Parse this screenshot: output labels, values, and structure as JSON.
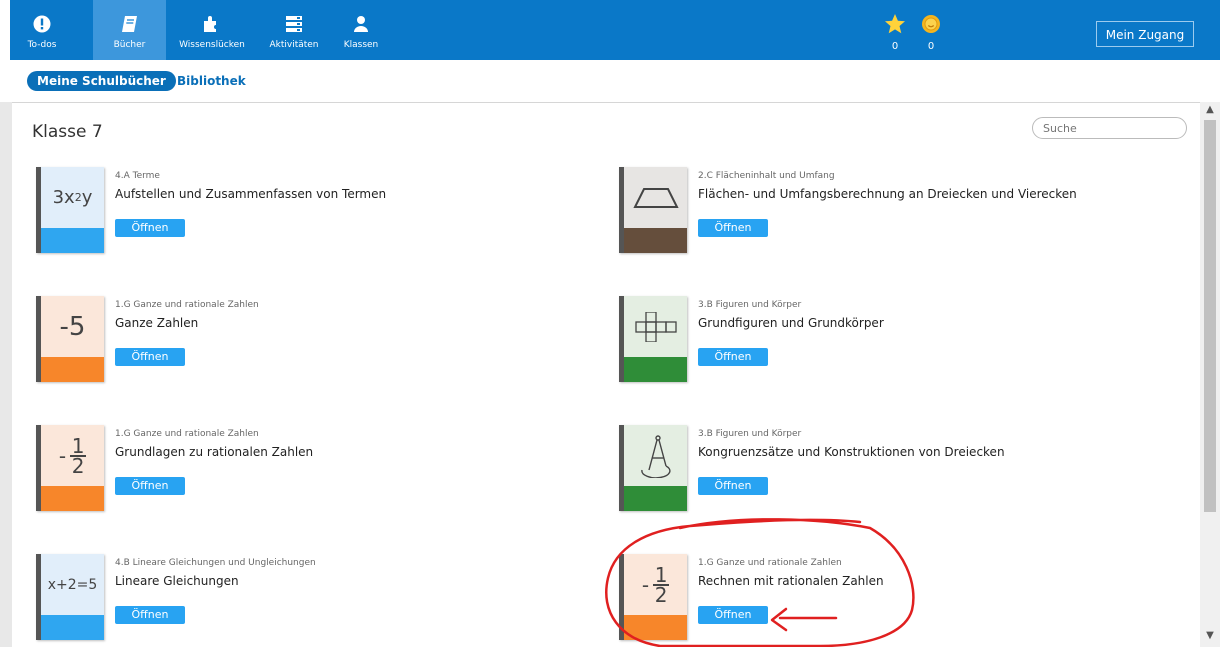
{
  "nav": {
    "items": [
      {
        "label": "To-dos",
        "icon": "exclamation-icon"
      },
      {
        "label": "Bücher",
        "icon": "book-icon"
      },
      {
        "label": "Wissenslücken",
        "icon": "puzzle-icon"
      },
      {
        "label": "Aktivitäten",
        "icon": "activities-icon"
      },
      {
        "label": "Klassen",
        "icon": "person-icon"
      }
    ],
    "stars": "0",
    "coins": "0",
    "account_label": "Mein Zugang"
  },
  "subnav": {
    "my_books": "Meine Schulbücher",
    "library": "Bibliothek"
  },
  "section": {
    "title": "Klasse 7",
    "search_placeholder": "Suche"
  },
  "open_label": "Öffnen",
  "colors": {
    "topbar": "#0a78c8",
    "button": "#28a3f2",
    "blue_cover": "#2fa6f0",
    "orange_cover": "#f7862a",
    "brown_cover": "#654e3c",
    "green_cover": "#2f8d38",
    "annotation": "#e02020"
  },
  "books": [
    {
      "chapter": "4.A Terme",
      "title": "Aufstellen und Zusammenfassen von Termen",
      "cover_text": "3x²y",
      "cover_theme": "blue"
    },
    {
      "chapter": "2.C Flächeninhalt und Umfang",
      "title": "Flächen- und Umfangsberechnung an Dreiecken und Vierecken",
      "cover_icon": "trapezoid-icon",
      "cover_theme": "brown"
    },
    {
      "chapter": "1.G Ganze und rationale Zahlen",
      "title": "Ganze Zahlen",
      "cover_text": "-5",
      "cover_theme": "orange"
    },
    {
      "chapter": "3.B Figuren und Körper",
      "title": "Grundfiguren und Grundkörper",
      "cover_icon": "cube-net-icon",
      "cover_theme": "green"
    },
    {
      "chapter": "1.G Ganze und rationale Zahlen",
      "title": "Grundlagen zu rationalen Zahlen",
      "cover_text": "-1/2",
      "cover_theme": "orange"
    },
    {
      "chapter": "3.B Figuren und Körper",
      "title": "Kongruenzsätze und Konstruktionen von Dreiecken",
      "cover_icon": "compass-icon",
      "cover_theme": "green"
    },
    {
      "chapter": "4.B Lineare Gleichungen und Ungleichungen",
      "title": "Lineare Gleichungen",
      "cover_text": "x+2=5",
      "cover_theme": "blue"
    },
    {
      "chapter": "1.G Ganze und rationale Zahlen",
      "title": "Rechnen mit rationalen Zahlen",
      "cover_text": "-1/2",
      "cover_theme": "orange"
    }
  ]
}
